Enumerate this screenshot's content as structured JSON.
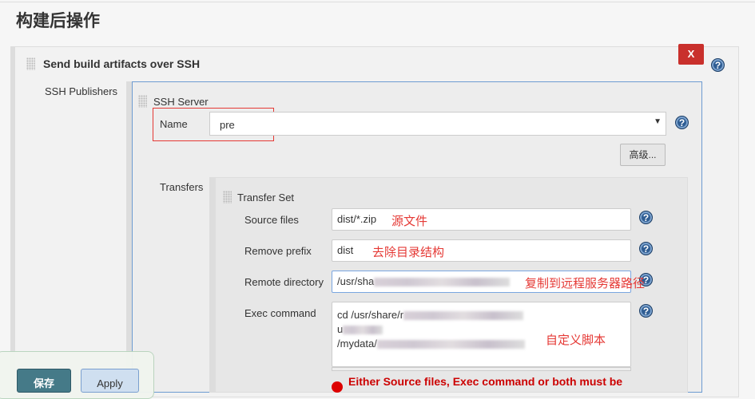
{
  "page": {
    "title": "构建后操作"
  },
  "publisher": {
    "title": "Send build artifacts over SSH",
    "delete_label": "X",
    "ssh_publishers_label": "SSH Publishers"
  },
  "server": {
    "section_label": "SSH Server",
    "name_label": "Name",
    "name_value": "pre",
    "advanced_label": "高级..."
  },
  "transfers": {
    "label": "Transfers",
    "set_label": "Transfer Set",
    "source_files_label": "Source files",
    "source_files_value": "dist/*.zip",
    "source_note": "源文件",
    "remove_prefix_label": "Remove prefix",
    "remove_prefix_value": "dist",
    "remove_note": "去除目录结构",
    "remote_dir_label": "Remote directory",
    "remote_dir_value": "/usr/sha",
    "remote_note": "复制到远程服务器路径",
    "exec_label": "Exec command",
    "exec_lines": [
      "cd /usr/share/r",
      "u",
      "/mydata/"
    ],
    "exec_note": "自定义脚本",
    "error": "Either Source files, Exec command or both must be"
  },
  "footer": {
    "save_label": "保存",
    "apply_label": "Apply"
  },
  "help_glyph": "?"
}
